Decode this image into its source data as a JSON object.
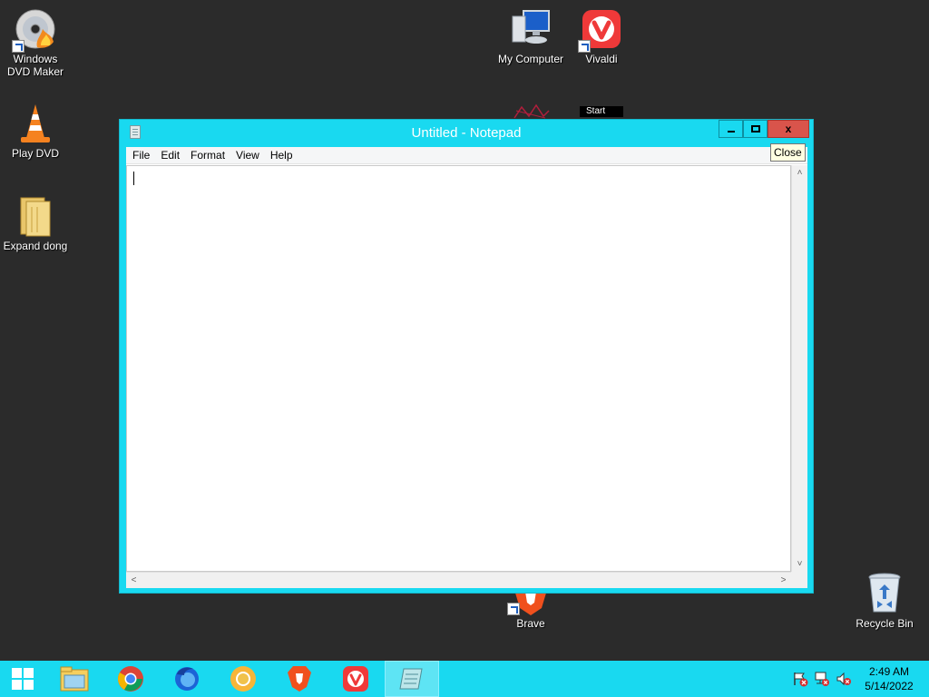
{
  "desktop": {
    "icons": [
      {
        "label": "Windows DVD Maker",
        "line1": "Windows",
        "line2": "DVD Maker"
      },
      {
        "label": "Play DVD"
      },
      {
        "label": "Expand dong"
      },
      {
        "label": "My Computer"
      },
      {
        "label": "Vivaldi"
      },
      {
        "label": "Brave"
      },
      {
        "label": "Recycle Bin"
      }
    ],
    "start_tooltip": "Start"
  },
  "notepad": {
    "title": "Untitled - Notepad",
    "menu": [
      "File",
      "Edit",
      "Format",
      "View",
      "Help"
    ],
    "content": "",
    "close_tooltip": "Close",
    "caption_buttons": {
      "minimize": "minimize",
      "maximize": "maximize",
      "close": "x"
    }
  },
  "taskbar": {
    "items": [
      "start",
      "file-explorer",
      "chrome",
      "firefox",
      "chrome-canary",
      "brave",
      "vivaldi",
      "notepad"
    ],
    "clock": {
      "time": "2:49 AM",
      "date": "5/14/2022"
    }
  },
  "colors": {
    "desktop_bg": "#2b2b2b",
    "accent": "#19d9f0",
    "close_red": "#d9544b"
  }
}
